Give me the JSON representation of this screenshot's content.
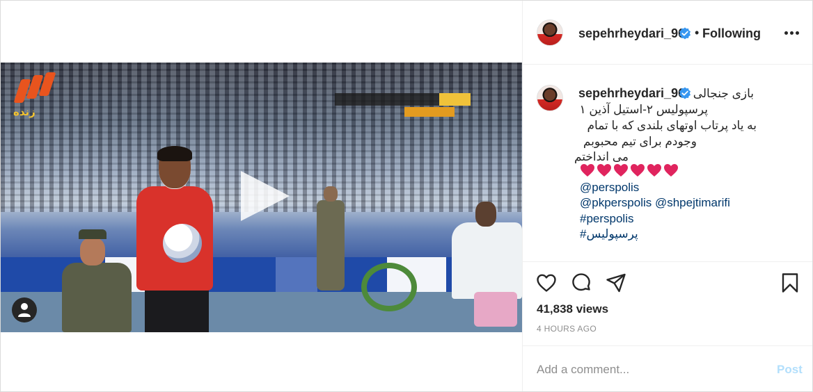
{
  "colors": {
    "link": "#00376b",
    "verified": "#3897f0",
    "heart": "#e0245e",
    "post_disabled": "#b2dffc",
    "muted": "#8e8e8e"
  },
  "header": {
    "username": "sepehrheydari_96",
    "separator": "•",
    "follow_status": "Following",
    "more_icon": "more-horizontal-icon"
  },
  "media": {
    "type": "video",
    "overlay_logo_text": "زنده",
    "play_icon": "play-icon",
    "tagged_icon": "user-tag-icon"
  },
  "caption": {
    "username": "sepehrheydari_96",
    "lines": [
      "بازی جنجالی",
      "پرسپولیس ۲-استیل آذین ۱",
      "به یاد پرتاب اوتهای بلندی که با تمام",
      "وجودم برای تیم محبوبم",
      "می انداختم"
    ],
    "hearts": [
      "❤️",
      "❤️",
      "❤️",
      "❤️",
      "❤️",
      "❤️"
    ],
    "mention_1": "@perspolis",
    "mentions_2": "@pkperspolis @shpejtimarifi",
    "hashtag_1": "#perspolis",
    "hashtag_2": "#پرسپولیس"
  },
  "actions": {
    "like_icon": "heart-outline-icon",
    "comment_icon": "comment-icon",
    "share_icon": "send-icon",
    "save_icon": "bookmark-icon"
  },
  "stats": {
    "views": "41,838 views",
    "time": "4 HOURS AGO"
  },
  "comment": {
    "placeholder": "Add a comment...",
    "post_label": "Post"
  }
}
